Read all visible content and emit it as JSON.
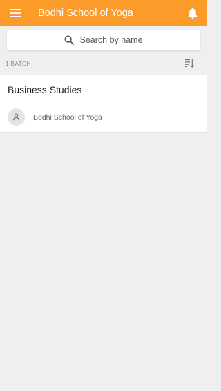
{
  "appbar": {
    "title": "Bodhi School of Yoga",
    "menu_icon": "hamburger-menu-icon",
    "notification_icon": "bell-icon",
    "color": "#fb9b2a"
  },
  "search": {
    "placeholder": "Search by name",
    "icon": "search-icon"
  },
  "list_header": {
    "count_label": "1 BATCH",
    "sort_icon": "sort-icon"
  },
  "batches": [
    {
      "name": "Business Studies",
      "owner": "Bodhi School of Yoga",
      "avatar_icon": "person-icon"
    }
  ],
  "colors": {
    "accent": "#fb9b2a",
    "background": "#efefef",
    "card": "#ffffff"
  }
}
